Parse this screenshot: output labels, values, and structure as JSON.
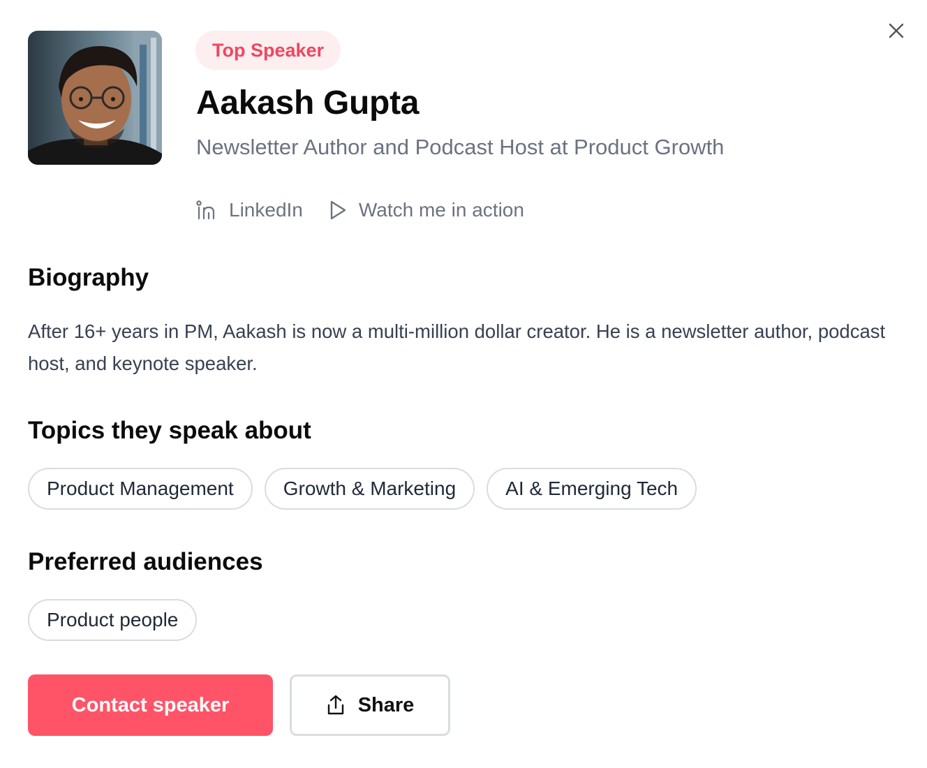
{
  "header": {
    "badge": "Top Speaker",
    "name": "Aakash Gupta",
    "title": "Newsletter Author and Podcast Host at Product Growth",
    "avatar_icon": "speaker-photo"
  },
  "links": [
    {
      "label": "LinkedIn",
      "icon": "linkedin-icon"
    },
    {
      "label": "Watch me in action",
      "icon": "play-icon"
    }
  ],
  "biography": {
    "heading": "Biography",
    "text": "After 16+ years in PM, Aakash is now a multi-million dollar creator. He is a newsletter author, podcast host, and keynote speaker."
  },
  "topics": {
    "heading": "Topics they speak about",
    "items": [
      "Product Management",
      "Growth & Marketing",
      "AI & Emerging Tech"
    ]
  },
  "audiences": {
    "heading": "Preferred audiences",
    "items": [
      "Product people"
    ]
  },
  "actions": {
    "contact_label": "Contact speaker",
    "share_label": "Share"
  },
  "colors": {
    "accent": "#ff5468",
    "badge_bg": "#fdeef0",
    "badge_text": "#f0465e",
    "muted_text": "#6b7280",
    "chip_border": "#d9dce1"
  }
}
